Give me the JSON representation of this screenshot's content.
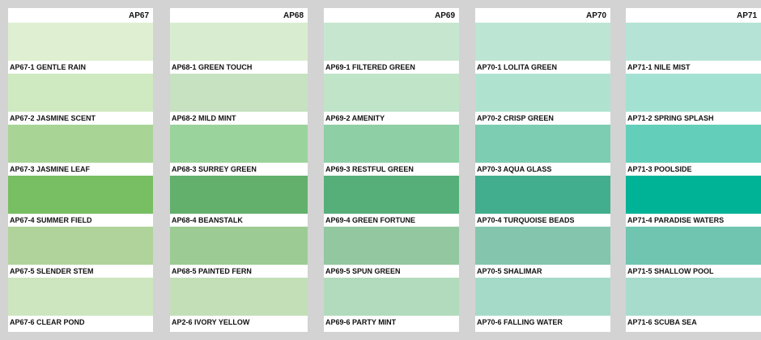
{
  "cards": [
    {
      "code": "AP67",
      "swatches": [
        {
          "label": "AP67-1  GENTLE RAIN",
          "color": "#dff0d2"
        },
        {
          "label": "AP67-2  JASMINE SCENT",
          "color": "#cfe9c1"
        },
        {
          "label": "AP67-3  JASMINE LEAF",
          "color": "#a8d596"
        },
        {
          "label": "AP67-4  SUMMER FIELD",
          "color": "#78be62"
        },
        {
          "label": "AP67-5  SLENDER STEM",
          "color": "#b0d39c"
        },
        {
          "label": "AP67-6  CLEAR POND",
          "color": "#cde6bf"
        }
      ]
    },
    {
      "code": "AP68",
      "swatches": [
        {
          "label": "AP68-1  GREEN TOUCH",
          "color": "#d8edcf"
        },
        {
          "label": "AP68-2  MILD MINT",
          "color": "#c6e2c0"
        },
        {
          "label": "AP68-3  SURREY GREEN",
          "color": "#9bd39c"
        },
        {
          "label": "AP68-4  BEANSTALK",
          "color": "#62b06b"
        },
        {
          "label": "AP68-5  PAINTED FERN",
          "color": "#9ccc93"
        },
        {
          "label": "AP2-6  IVORY YELLOW",
          "color": "#c3dfb8"
        }
      ]
    },
    {
      "code": "AP69",
      "swatches": [
        {
          "label": "AP69-1  FILTERED GREEN",
          "color": "#c7e6d0"
        },
        {
          "label": "AP69-2  AMENITY",
          "color": "#bfe4c8"
        },
        {
          "label": "AP69-3  RESTFUL GREEN",
          "color": "#8ecfa5"
        },
        {
          "label": "AP69-4  GREEN FORTUNE",
          "color": "#56af79"
        },
        {
          "label": "AP69-5  SPUN GREEN",
          "color": "#92c7a0"
        },
        {
          "label": "AP69-6  PARTY MINT",
          "color": "#b2dbbd"
        }
      ]
    },
    {
      "code": "AP70",
      "swatches": [
        {
          "label": "AP70-1  LOLITA GREEN",
          "color": "#bde5d3"
        },
        {
          "label": "AP70-2  CRISP GREEN",
          "color": "#afe3d0"
        },
        {
          "label": "AP70-3  AQUA GLASS",
          "color": "#7ccdb2"
        },
        {
          "label": "AP70-4  TURQUOISE BEADS",
          "color": "#42ae8d"
        },
        {
          "label": "AP70-5  SHALIMAR",
          "color": "#84c6ad"
        },
        {
          "label": "AP70-6  FALLING WATER",
          "color": "#a6dac8"
        }
      ]
    },
    {
      "code": "AP71",
      "swatches": [
        {
          "label": "AP71-1  NILE MIST",
          "color": "#b5e4d6"
        },
        {
          "label": "AP71-2  SPRING SPLASH",
          "color": "#a3e2d3"
        },
        {
          "label": "AP71-3  POOLSIDE",
          "color": "#63cfba"
        },
        {
          "label": "AP71-4  PARADISE WATERS",
          "color": "#00b397"
        },
        {
          "label": "AP71-5  SHALLOW POOL",
          "color": "#70c5b0"
        },
        {
          "label": "AP71-6  SCUBA SEA",
          "color": "#a7dccd"
        }
      ]
    }
  ]
}
